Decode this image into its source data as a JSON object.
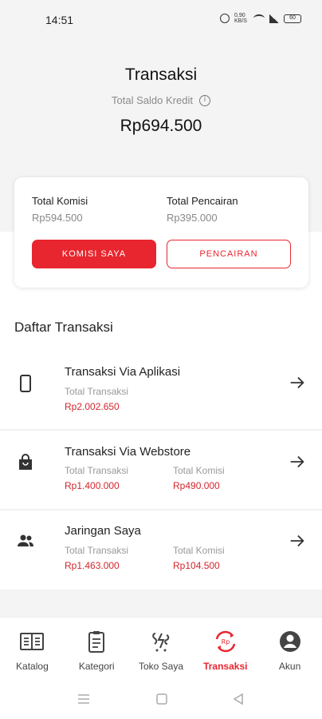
{
  "status_bar": {
    "time": "14:51",
    "data_speed": "0,90 KB/S",
    "battery": "60"
  },
  "header": {
    "title": "Transaksi",
    "saldo_label": "Total Saldo Kredit",
    "saldo_value": "Rp694.500"
  },
  "summary": {
    "komisi_label": "Total Komisi",
    "komisi_value": "Rp594.500",
    "pencairan_label": "Total Pencairan",
    "pencairan_value": "Rp395.000",
    "komisi_button": "KOMISI SAYA",
    "pencairan_button": "PENCAIRAN"
  },
  "section_title": "Daftar Transaksi",
  "transactions": [
    {
      "icon": "smartphone-icon",
      "title": "Transaksi Via Aplikasi",
      "label1": "Total Transaksi",
      "value1": "Rp2.002.650"
    },
    {
      "icon": "shopping-bag-icon",
      "title": "Transaksi Via Webstore",
      "label1": "Total Transaksi",
      "value1": "Rp1.400.000",
      "label2": "Total Komisi",
      "value2": "Rp490.000"
    },
    {
      "icon": "people-icon",
      "title": "Jaringan Saya",
      "label1": "Total Transaksi",
      "value1": "Rp1.463.000",
      "label2": "Total Komisi",
      "value2": "Rp104.500"
    }
  ],
  "bottom_nav": [
    {
      "label": "Katalog",
      "icon": "book-icon",
      "active": false
    },
    {
      "label": "Kategori",
      "icon": "clipboard-icon",
      "active": false
    },
    {
      "label": "Toko Saya",
      "icon": "store-icon",
      "active": false
    },
    {
      "label": "Transaksi",
      "icon": "transaction-icon",
      "active": true
    },
    {
      "label": "Akun",
      "icon": "account-icon",
      "active": false
    }
  ],
  "colors": {
    "accent": "#e8262f",
    "value_red": "#d4262d",
    "muted_text": "#999999",
    "header_bg": "#f4f4f4"
  }
}
